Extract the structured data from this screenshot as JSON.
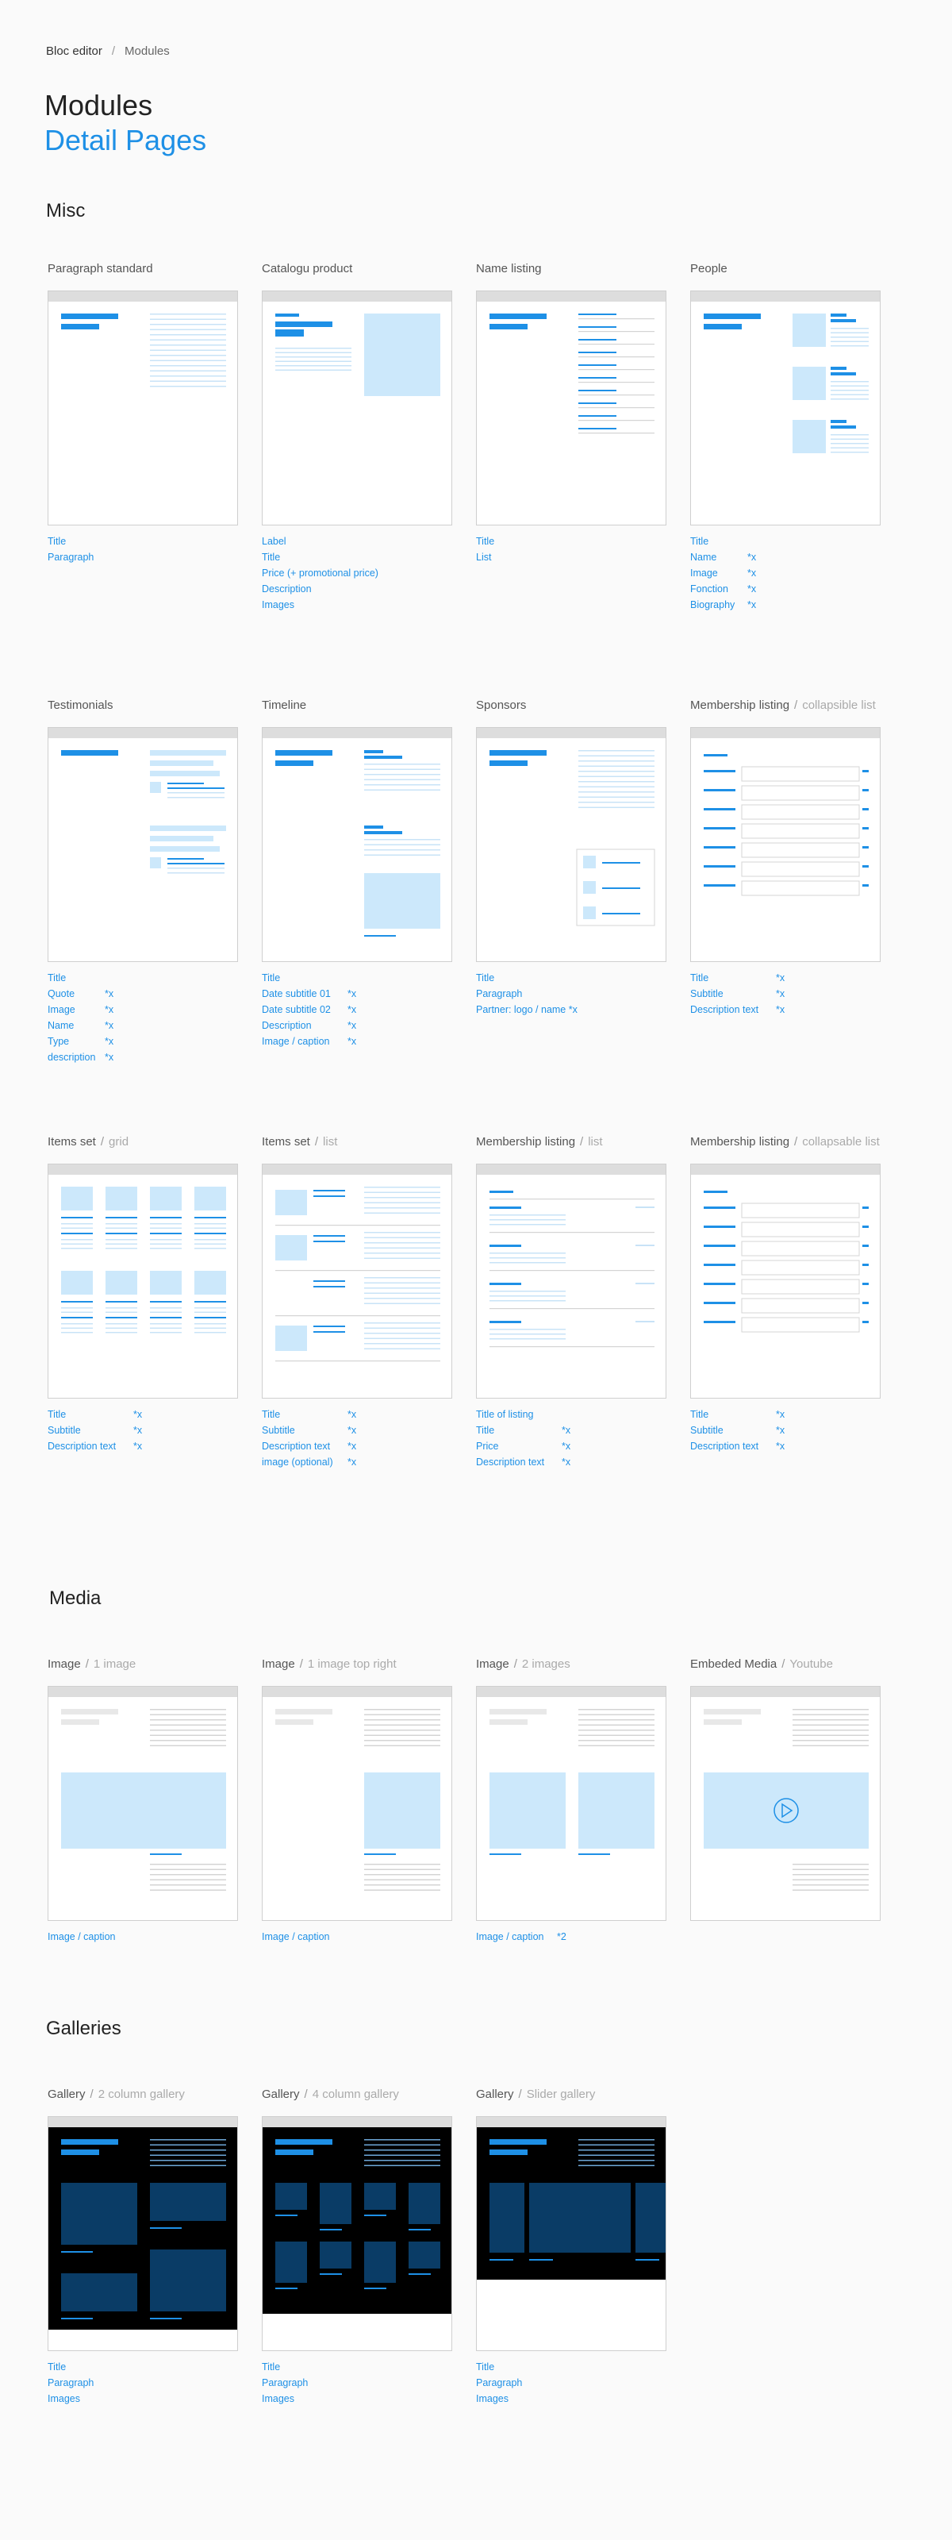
{
  "breadcrumb": {
    "root": "Bloc editor",
    "separator": "/",
    "current": "Modules"
  },
  "title": "Modules",
  "subtitle": "Detail Pages",
  "colors": {
    "accent": "#1e90e6",
    "light_blue": "#cce8fb",
    "dark_blue": "#0a3c66",
    "line": "#c8e3f7",
    "gray_line": "#d4d4d4"
  },
  "sections": {
    "misc": "Misc",
    "media": "Media",
    "galleries": "Galleries"
  },
  "misc": [
    {
      "title": "Paragraph standard",
      "sub": "",
      "labels": [
        [
          "Title",
          ""
        ],
        [
          "Paragraph",
          ""
        ]
      ]
    },
    {
      "title": "Catalogu product",
      "sub": "",
      "labels": [
        [
          "Label",
          ""
        ],
        [
          "Title",
          ""
        ],
        [
          "Price (+ promotional price)",
          ""
        ],
        [
          "Description",
          ""
        ],
        [
          "Images",
          ""
        ]
      ]
    },
    {
      "title": "Name listing",
      "sub": "",
      "labels": [
        [
          "Title",
          ""
        ],
        [
          "List",
          ""
        ]
      ]
    },
    {
      "title": "People",
      "sub": "",
      "labels": [
        [
          "Title",
          ""
        ],
        [
          "Name",
          "*x"
        ],
        [
          "Image",
          "*x"
        ],
        [
          "Fonction",
          "*x"
        ],
        [
          "Biography",
          "*x"
        ]
      ]
    },
    {
      "title": "Testimonials",
      "sub": "",
      "labels": [
        [
          "Title",
          ""
        ],
        [
          "Quote",
          "*x"
        ],
        [
          "Image",
          "*x"
        ],
        [
          "Name",
          "*x"
        ],
        [
          "Type",
          "*x"
        ],
        [
          "description",
          "*x"
        ]
      ]
    },
    {
      "title": "Timeline",
      "sub": "",
      "labels": [
        [
          "Title",
          ""
        ],
        [
          "Date subtitle 01",
          "*x"
        ],
        [
          "Date subtitle 02",
          "*x"
        ],
        [
          "Description",
          "*x"
        ],
        [
          "Image / caption",
          "*x"
        ]
      ]
    },
    {
      "title": "Sponsors",
      "sub": "",
      "labels": [
        [
          "Title",
          ""
        ],
        [
          "Paragraph",
          ""
        ],
        [
          "Partner: logo / name *x",
          ""
        ]
      ]
    },
    {
      "title": "Membership listing",
      "sub": "collapsible list",
      "labels": [
        [
          "Title",
          "*x"
        ],
        [
          "Subtitle",
          "*x"
        ],
        [
          "Description text",
          "*x"
        ]
      ]
    },
    {
      "title": "Items set",
      "sub": "grid",
      "labels": [
        [
          "Title",
          "*x"
        ],
        [
          "Subtitle",
          "*x"
        ],
        [
          "Description text",
          "*x"
        ]
      ]
    },
    {
      "title": "Items set",
      "sub": "list",
      "labels": [
        [
          "Title",
          "*x"
        ],
        [
          "Subtitle",
          "*x"
        ],
        [
          "Description text",
          "*x"
        ],
        [
          "image (optional)",
          "*x"
        ]
      ]
    },
    {
      "title": "Membership listing",
      "sub": "list",
      "labels": [
        [
          "Title of listing",
          ""
        ],
        [
          "Title",
          "*x"
        ],
        [
          "Price",
          "*x"
        ],
        [
          "Description text",
          "*x"
        ]
      ]
    },
    {
      "title": "Membership listing",
      "sub": "collapsable list",
      "labels": [
        [
          "Title",
          "*x"
        ],
        [
          "Subtitle",
          "*x"
        ],
        [
          "Description text",
          "*x"
        ]
      ]
    }
  ],
  "media": [
    {
      "title": "Image",
      "sub": "1 image",
      "labels": [
        [
          "Image / caption",
          ""
        ]
      ]
    },
    {
      "title": "Image",
      "sub": "1 image top right",
      "labels": [
        [
          "Image / caption",
          ""
        ]
      ]
    },
    {
      "title": "Image",
      "sub": "2 images",
      "labels": [
        [
          "Image / caption",
          "*2"
        ]
      ]
    },
    {
      "title": "Embeded Media",
      "sub": "Youtube",
      "labels": []
    }
  ],
  "galleries": [
    {
      "title": "Gallery",
      "sub": "2 column gallery",
      "labels": [
        [
          "Title",
          ""
        ],
        [
          "Paragraph",
          ""
        ],
        [
          "Images",
          ""
        ]
      ]
    },
    {
      "title": "Gallery",
      "sub": "4 column gallery",
      "labels": [
        [
          "Title",
          ""
        ],
        [
          "Paragraph",
          ""
        ],
        [
          "Images",
          ""
        ]
      ]
    },
    {
      "title": "Gallery",
      "sub": "Slider gallery",
      "labels": [
        [
          "Title",
          ""
        ],
        [
          "Paragraph",
          ""
        ],
        [
          "Images",
          ""
        ]
      ]
    }
  ]
}
